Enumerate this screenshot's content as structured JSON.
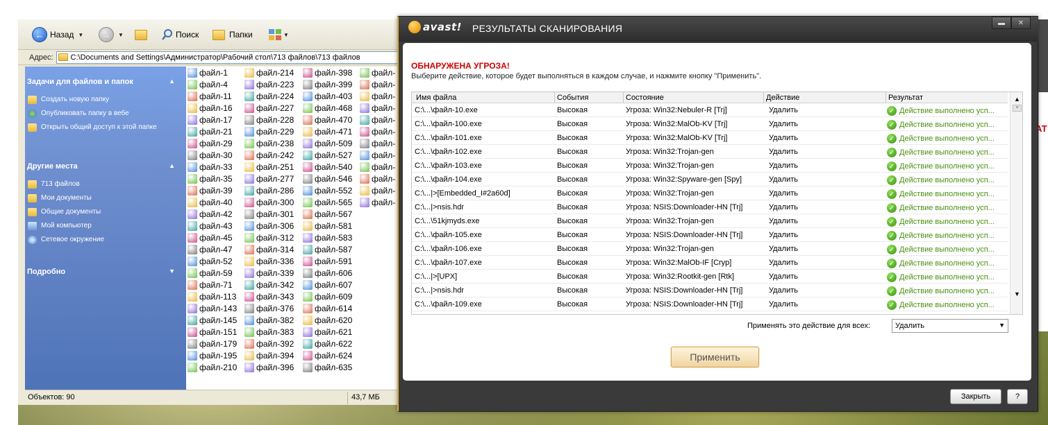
{
  "explorer": {
    "toolbar": {
      "back_label": "Назад",
      "search_label": "Поиск",
      "folders_label": "Папки"
    },
    "address": {
      "label": "Адрес:",
      "value": "C:\\Documents and Settings\\Администратор\\Рабочий стол\\713 файлов\\713 файлов"
    },
    "taskpane": {
      "tasks_title": "Задачи для файлов и папок",
      "tasks": [
        "Создать новую папку",
        "Опубликовать папку в вебе",
        "Открыть общий доступ к этой папке"
      ],
      "places_title": "Другие места",
      "places": [
        "713 файлов",
        "Мои документы",
        "Общие документы",
        "Мой компьютер",
        "Сетевое окружение"
      ],
      "details_title": "Подробно"
    },
    "files": {
      "col1": [
        "файл-1",
        "файл-4",
        "файл-11",
        "файл-16",
        "файл-17",
        "файл-21",
        "файл-29",
        "файл-30",
        "файл-33",
        "файл-35",
        "файл-39",
        "файл-40",
        "файл-42",
        "файл-43",
        "файл-45",
        "файл-47",
        "файл-52",
        "файл-59",
        "файл-71",
        "файл-113",
        "файл-143",
        "файл-145",
        "файл-151",
        "файл-179",
        "файл-195",
        "файл-210"
      ],
      "col2": [
        "файл-214",
        "файл-223",
        "файл-224",
        "файл-227",
        "файл-228",
        "файл-229",
        "файл-238",
        "файл-242",
        "файл-251",
        "файл-277",
        "файл-286",
        "файл-300",
        "файл-301",
        "файл-306",
        "файл-312",
        "файл-314",
        "файл-336",
        "файл-339",
        "файл-342",
        "файл-343",
        "файл-376",
        "файл-382",
        "файл-383",
        "файл-392",
        "файл-394",
        "файл-396"
      ],
      "col3": [
        "файл-398",
        "файл-399",
        "файл-403",
        "файл-468",
        "файл-470",
        "файл-471",
        "файл-509",
        "файл-527",
        "файл-540",
        "файл-546",
        "файл-552",
        "файл-565",
        "файл-567",
        "файл-581",
        "файл-583",
        "файл-587",
        "файл-591",
        "файл-606",
        "файл-607",
        "файл-609",
        "файл-614",
        "файл-620",
        "файл-621",
        "файл-622",
        "файл-624",
        "файл-635"
      ],
      "col4": [
        "файл-",
        "файл-",
        "файл-",
        "файл-",
        "файл-",
        "файл-",
        "файл-",
        "файл-",
        "файл-",
        "файл-",
        "файл-",
        "файл-"
      ]
    },
    "status": {
      "objects": "Объектов: 90",
      "size": "43,7 МБ"
    }
  },
  "avast": {
    "brand": "avast!",
    "title": "РЕЗУЛЬТАТЫ СКАНИРОВАНИЯ",
    "threat_title": "ОБНАРУЖЕНА УГРОЗА!",
    "threat_sub": "Выберите действие, которое будет выполняться в каждом случае, и нажмите кнопку \"Применить\".",
    "columns": [
      "Имя файла",
      "События",
      "Состояние",
      "Действие",
      "Результат"
    ],
    "rows": [
      [
        "C:\\...\\файл-10.exe",
        "Высокая",
        "Угроза: Win32:Nebuler-R [Trj]",
        "Удалить",
        "Действие выполнено усп..."
      ],
      [
        "C:\\...\\файл-100.exe",
        "Высокая",
        "Угроза: Win32:MalOb-KV [Trj]",
        "Удалить",
        "Действие выполнено усп..."
      ],
      [
        "C:\\...\\файл-101.exe",
        "Высокая",
        "Угроза: Win32:MalOb-KV [Trj]",
        "Удалить",
        "Действие выполнено усп..."
      ],
      [
        "C:\\...\\файл-102.exe",
        "Высокая",
        "Угроза: Win32:Trojan-gen",
        "Удалить",
        "Действие выполнено усп..."
      ],
      [
        "C:\\...\\файл-103.exe",
        "Высокая",
        "Угроза: Win32:Trojan-gen",
        "Удалить",
        "Действие выполнено усп..."
      ],
      [
        "C:\\...\\файл-104.exe",
        "Высокая",
        "Угроза: Win32:Spyware-gen [Spy]",
        "Удалить",
        "Действие выполнено усп..."
      ],
      [
        "C:\\...|>[Embedded_I#2a60d]",
        "Высокая",
        "Угроза: Win32:Trojan-gen",
        "Удалить",
        "Действие выполнено усп..."
      ],
      [
        "C:\\...|>nsis.hdr",
        "Высокая",
        "Угроза: NSIS:Downloader-HN [Trj]",
        "Удалить",
        "Действие выполнено усп..."
      ],
      [
        "C:\\...\\51kjmyds.exe",
        "Высокая",
        "Угроза: Win32:Trojan-gen",
        "Удалить",
        "Действие выполнено усп..."
      ],
      [
        "C:\\...\\файл-105.exe",
        "Высокая",
        "Угроза: NSIS:Downloader-HN [Trj]",
        "Удалить",
        "Действие выполнено усп..."
      ],
      [
        "C:\\...\\файл-106.exe",
        "Высокая",
        "Угроза: Win32:Trojan-gen",
        "Удалить",
        "Действие выполнено усп..."
      ],
      [
        "C:\\...\\файл-107.exe",
        "Высокая",
        "Угроза: Win32:MalOb-IF [Cryp]",
        "Удалить",
        "Действие выполнено усп..."
      ],
      [
        "C:\\...|>[UPX]",
        "Высокая",
        "Угроза: Win32:Rootkit-gen [Rtk]",
        "Удалить",
        "Действие выполнено усп..."
      ],
      [
        "C:\\...|>nsis.hdr",
        "Высокая",
        "Угроза: NSIS:Downloader-HN [Trj]",
        "Удалить",
        "Действие выполнено усп..."
      ],
      [
        "C:\\...\\файл-109.exe",
        "Высокая",
        "Угроза: NSIS:Downloader-HN [Trj]",
        "Удалить",
        "Действие выполнено усп..."
      ]
    ],
    "apply_all_label": "Применять это действие для всех:",
    "apply_all_value": "Удалить",
    "apply_button": "Применить",
    "close_button": "Закрыть",
    "help_button": "?",
    "colors": {
      "accent": "#d7a93a",
      "threat": "#cc0000",
      "success": "#4a8f12"
    }
  },
  "peek_text": "АТ"
}
